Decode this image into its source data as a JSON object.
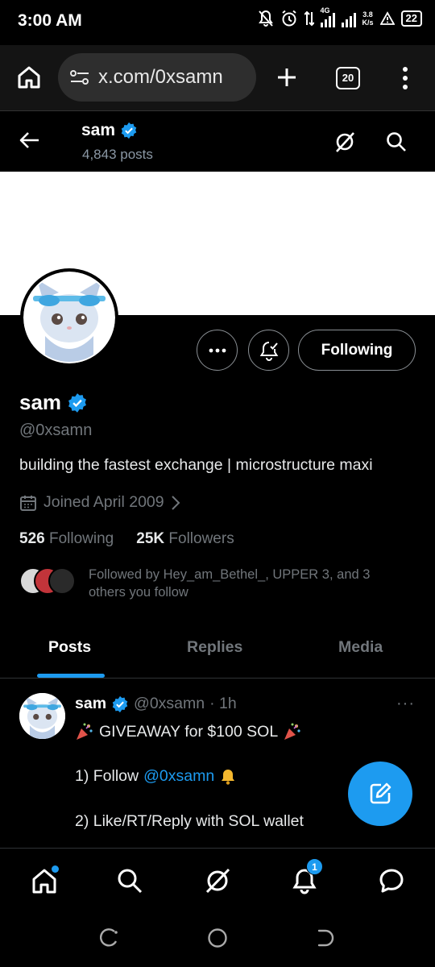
{
  "status_bar": {
    "time": "3:00 AM",
    "network": "4G",
    "net_speed_value": "3.8",
    "net_speed_unit": "K/s",
    "battery": "22"
  },
  "browser": {
    "url": "x.com/0xsamn",
    "tab_count": "20"
  },
  "header": {
    "name": "sam",
    "posts_count": "4,843 posts"
  },
  "profile": {
    "display_name": "sam",
    "handle": "@0xsamn",
    "bio": "building the fastest exchange | microstructure maxi",
    "joined": "Joined April 2009",
    "following_count": "526",
    "following_label": "Following",
    "followers_count": "25K",
    "followers_label": "Followers",
    "followed_by": "Followed by Hey_am_Bethel_, UPPER 3, and 3 others you follow",
    "follow_button": "Following",
    "verified_color": "#1d9bf0"
  },
  "tabs": [
    {
      "label": "Posts",
      "active": true
    },
    {
      "label": "Replies",
      "active": false
    },
    {
      "label": "Media",
      "active": false
    }
  ],
  "tweet": {
    "name": "sam",
    "handle": "@0xsamn",
    "time": "· 1h",
    "more": "···",
    "line1": "GIVEAWAY for $100 SOL",
    "line2_prefix": "1) Follow",
    "line2_mention": "@0xsamn",
    "line3": "2) Like/RT/Reply with SOL wallet"
  },
  "bottom_nav": {
    "notifications_badge": "1"
  },
  "colors": {
    "accent": "#1d9bf0",
    "muted": "#71767b",
    "background": "#000000"
  }
}
